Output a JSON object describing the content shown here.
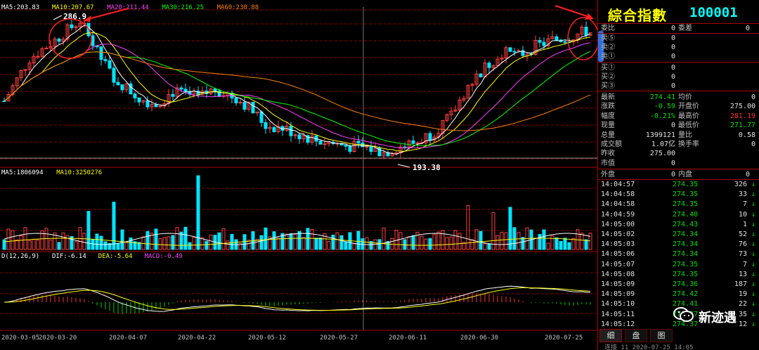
{
  "chart": {
    "ma_legend": [
      {
        "text": "MA5:203.83",
        "color": "#ffffff"
      },
      {
        "text": "MA10:207.67",
        "color": "#ffff00"
      },
      {
        "text": "MA20:211.44",
        "color": "#ff40ff"
      },
      {
        "text": "MA30:216.25",
        "color": "#00ff00"
      },
      {
        "text": "MA60:230.88",
        "color": "#ff8000"
      }
    ],
    "high_label": "286.9",
    "low_label": "193.38",
    "vol_legend": [
      {
        "text": "MA5:1806094",
        "color": "#ffffff"
      },
      {
        "text": "MA10:3250276",
        "color": "#ffff00"
      }
    ],
    "macd_legend": [
      {
        "text": "D(12,26,9)",
        "color": "#ffffff"
      },
      {
        "text": "DIF:-6.14",
        "color": "#ffffff"
      },
      {
        "text": "DEA:-5.64",
        "color": "#ffff00"
      },
      {
        "text": "MACD:-0.49",
        "color": "#ff40ff"
      }
    ],
    "dates": [
      "2020-03-05",
      "2020-03-20",
      "2020-04-07",
      "2020-04-22",
      "2020-05-12",
      "2020-05-27",
      "2020-06-11",
      "2020-06-30",
      "2020-07-25"
    ]
  },
  "panel": {
    "name": "綜合指數",
    "code": "100001",
    "weibi_label": "委比",
    "weibi_value": "0",
    "weicha_label": "委差",
    "weicha_value": "0",
    "sell": [
      {
        "label": "卖⑤",
        "value": "0"
      },
      {
        "label": "卖②",
        "value": "0"
      },
      {
        "label": "卖①",
        "value": "0"
      }
    ],
    "buy": [
      {
        "label": "买①",
        "value": "0"
      },
      {
        "label": "买②",
        "value": "0"
      },
      {
        "label": "买③",
        "value": "0"
      }
    ],
    "quote": [
      {
        "l1": "最新",
        "v1": "274.41",
        "c1": "g",
        "l2": "均价",
        "v2": "0",
        "c2": "w"
      },
      {
        "l1": "涨跌",
        "v1": "-0.59",
        "c1": "g",
        "l2": "开盘价",
        "v2": "275.00",
        "c2": "w"
      },
      {
        "l1": "幅度",
        "v1": "-0.21%",
        "c1": "g",
        "l2": "最高价",
        "v2": "281.19",
        "c2": "r"
      },
      {
        "l1": "现量",
        "v1": "0",
        "c1": "w",
        "l2": "最低价",
        "v2": "271.77",
        "c2": "g"
      },
      {
        "l1": "总量",
        "v1": "1399121",
        "c1": "w",
        "l2": "量比",
        "v2": "0.58",
        "c2": "w"
      },
      {
        "l1": "成交额",
        "v1": "1.07亿",
        "c1": "w",
        "l2": "换手率",
        "v2": "0",
        "c2": "w"
      },
      {
        "l1": "昨收",
        "v1": "275.00",
        "c1": "w",
        "l2": "",
        "v2": "",
        "c2": "w"
      },
      {
        "l1": "市值",
        "v1": "0",
        "c1": "w",
        "l2": "",
        "v2": "",
        "c2": "w"
      }
    ],
    "waipan_label": "外盘",
    "waipan_value": "0",
    "neipan_label": "内盘",
    "neipan_value": "0",
    "ticks": [
      {
        "t": "14:04:57",
        "p": "274.35",
        "v": "326",
        "d": "down"
      },
      {
        "t": "14:04:58",
        "p": "274.35",
        "v": "33",
        "d": "down"
      },
      {
        "t": "14:04:58",
        "p": "274.35",
        "v": "7",
        "d": "down"
      },
      {
        "t": "14:04:59",
        "p": "274.40",
        "v": "10",
        "d": "down"
      },
      {
        "t": "14:05:00",
        "p": "274.43",
        "v": "1",
        "d": "down"
      },
      {
        "t": "14:05:02",
        "p": "274.34",
        "v": "52",
        "d": "down"
      },
      {
        "t": "14:05:03",
        "p": "274.34",
        "v": "76",
        "d": "down"
      },
      {
        "t": "14:05:06",
        "p": "274.34",
        "v": "73",
        "d": "down"
      },
      {
        "t": "14:05:07",
        "p": "274.35",
        "v": "7",
        "d": "down"
      },
      {
        "t": "14:05:08",
        "p": "274.35",
        "v": "13",
        "d": "down"
      },
      {
        "t": "14:05:09",
        "p": "274.36",
        "v": "187",
        "d": "down"
      },
      {
        "t": "14:05:09",
        "p": "274.42",
        "v": "19",
        "d": "down"
      },
      {
        "t": "14:05:10",
        "p": "274.41",
        "v": "22",
        "d": "down"
      },
      {
        "t": "14:05:11",
        "p": "274.37",
        "v": "35",
        "d": "down"
      },
      {
        "t": "14:05:12",
        "p": "274.37",
        "v": "12",
        "d": "down"
      }
    ],
    "tabs": [
      "细",
      "盘",
      "图"
    ],
    "bottom_text": "连接 11   2020-07-25 14:05"
  },
  "watermark": "新迹遇",
  "colors": {
    "up": "#ff4040",
    "down": "#00e5ff",
    "grid": "#8b0000",
    "annot": "#ff2020"
  }
}
